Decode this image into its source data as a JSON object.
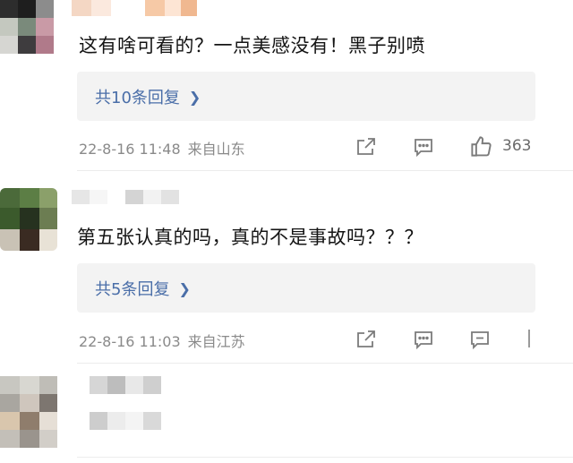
{
  "comments": [
    {
      "text": "这有啥可看的？一点美感没有！黑子别喷",
      "replies_label": "共10条回复",
      "date": "22-8-16 11:48",
      "location": "来自山东",
      "like_count": "363"
    },
    {
      "text": "第五张认真的吗，真的不是事故吗？？？",
      "replies_label": "共5条回复",
      "date": "22-8-16 11:03",
      "location": "来自江苏",
      "like_count": ""
    },
    {
      "text": "",
      "replies_label": "",
      "date": "",
      "location": "",
      "like_count": ""
    }
  ],
  "icons": {
    "share": "share-icon",
    "comment": "comment-icon",
    "like": "thumbs-up-icon"
  },
  "colors": {
    "link": "#4a6ea8",
    "meta": "#8a8a8a",
    "reply_bg": "#f3f3f3"
  }
}
